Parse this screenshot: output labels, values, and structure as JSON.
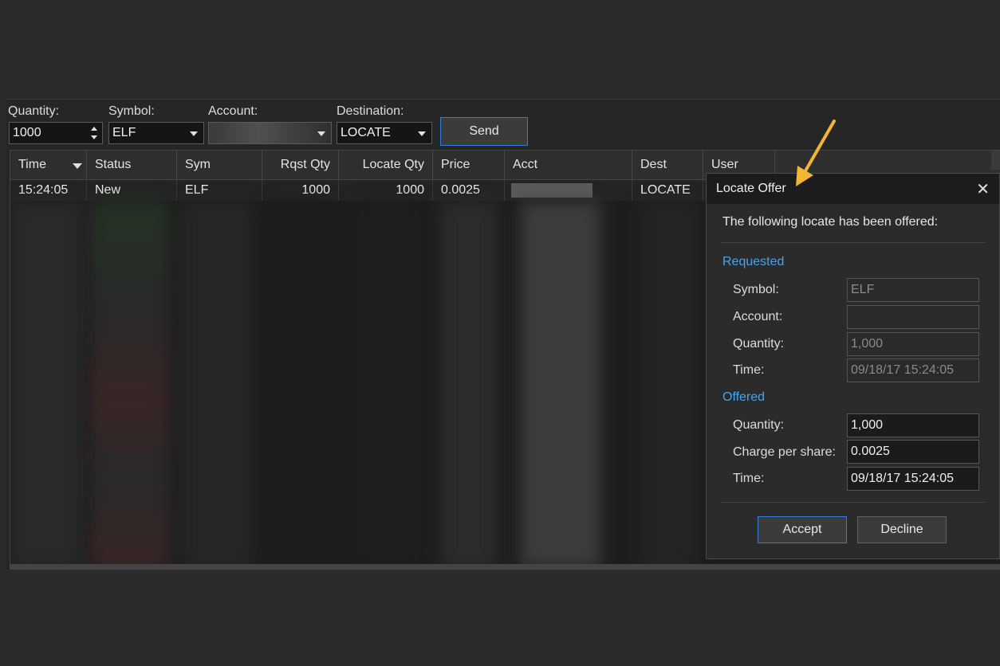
{
  "order_entry": {
    "quantity_label": "Quantity:",
    "quantity_value": "1000",
    "symbol_label": "Symbol:",
    "symbol_value": "ELF",
    "account_label": "Account:",
    "account_value": "",
    "destination_label": "Destination:",
    "destination_value": "LOCATE",
    "send_label": "Send"
  },
  "grid": {
    "columns": [
      "Time",
      "Status",
      "Sym",
      "Rqst Qty",
      "Locate Qty",
      "Price",
      "Acct",
      "Dest",
      "User"
    ],
    "rows": [
      {
        "time": "15:24:05",
        "status": "New",
        "sym": "ELF",
        "rqst_qty": "1000",
        "locate_qty": "1000",
        "price": "0.0025",
        "acct": "",
        "dest": "LOCATE"
      }
    ]
  },
  "dialog": {
    "title": "Locate Offer",
    "close_glyph": "✕",
    "message": "The following locate has been offered:",
    "requested": {
      "heading": "Requested",
      "symbol_label": "Symbol:",
      "symbol_value": "ELF",
      "account_label": "Account:",
      "account_value": "",
      "quantity_label": "Quantity:",
      "quantity_value": "1,000",
      "time_label": "Time:",
      "time_value": "09/18/17 15:24:05"
    },
    "offered": {
      "heading": "Offered",
      "quantity_label": "Quantity:",
      "quantity_value": "1,000",
      "charge_label": "Charge per share:",
      "charge_value": "0.0025",
      "time_label": "Time:",
      "time_value": "09/18/17 15:24:05"
    },
    "accept_label": "Accept",
    "decline_label": "Decline"
  },
  "colors": {
    "accent_blue": "#2f7ed8",
    "section_blue": "#4aa3e8",
    "annotation_arrow": "#f2b632"
  },
  "icons": {
    "close": "close-icon",
    "dropdown": "chevron-down-icon",
    "spinner": "spinner-arrows-icon",
    "sort": "sort-down-icon",
    "annotation": "arrow-annotation-icon"
  }
}
